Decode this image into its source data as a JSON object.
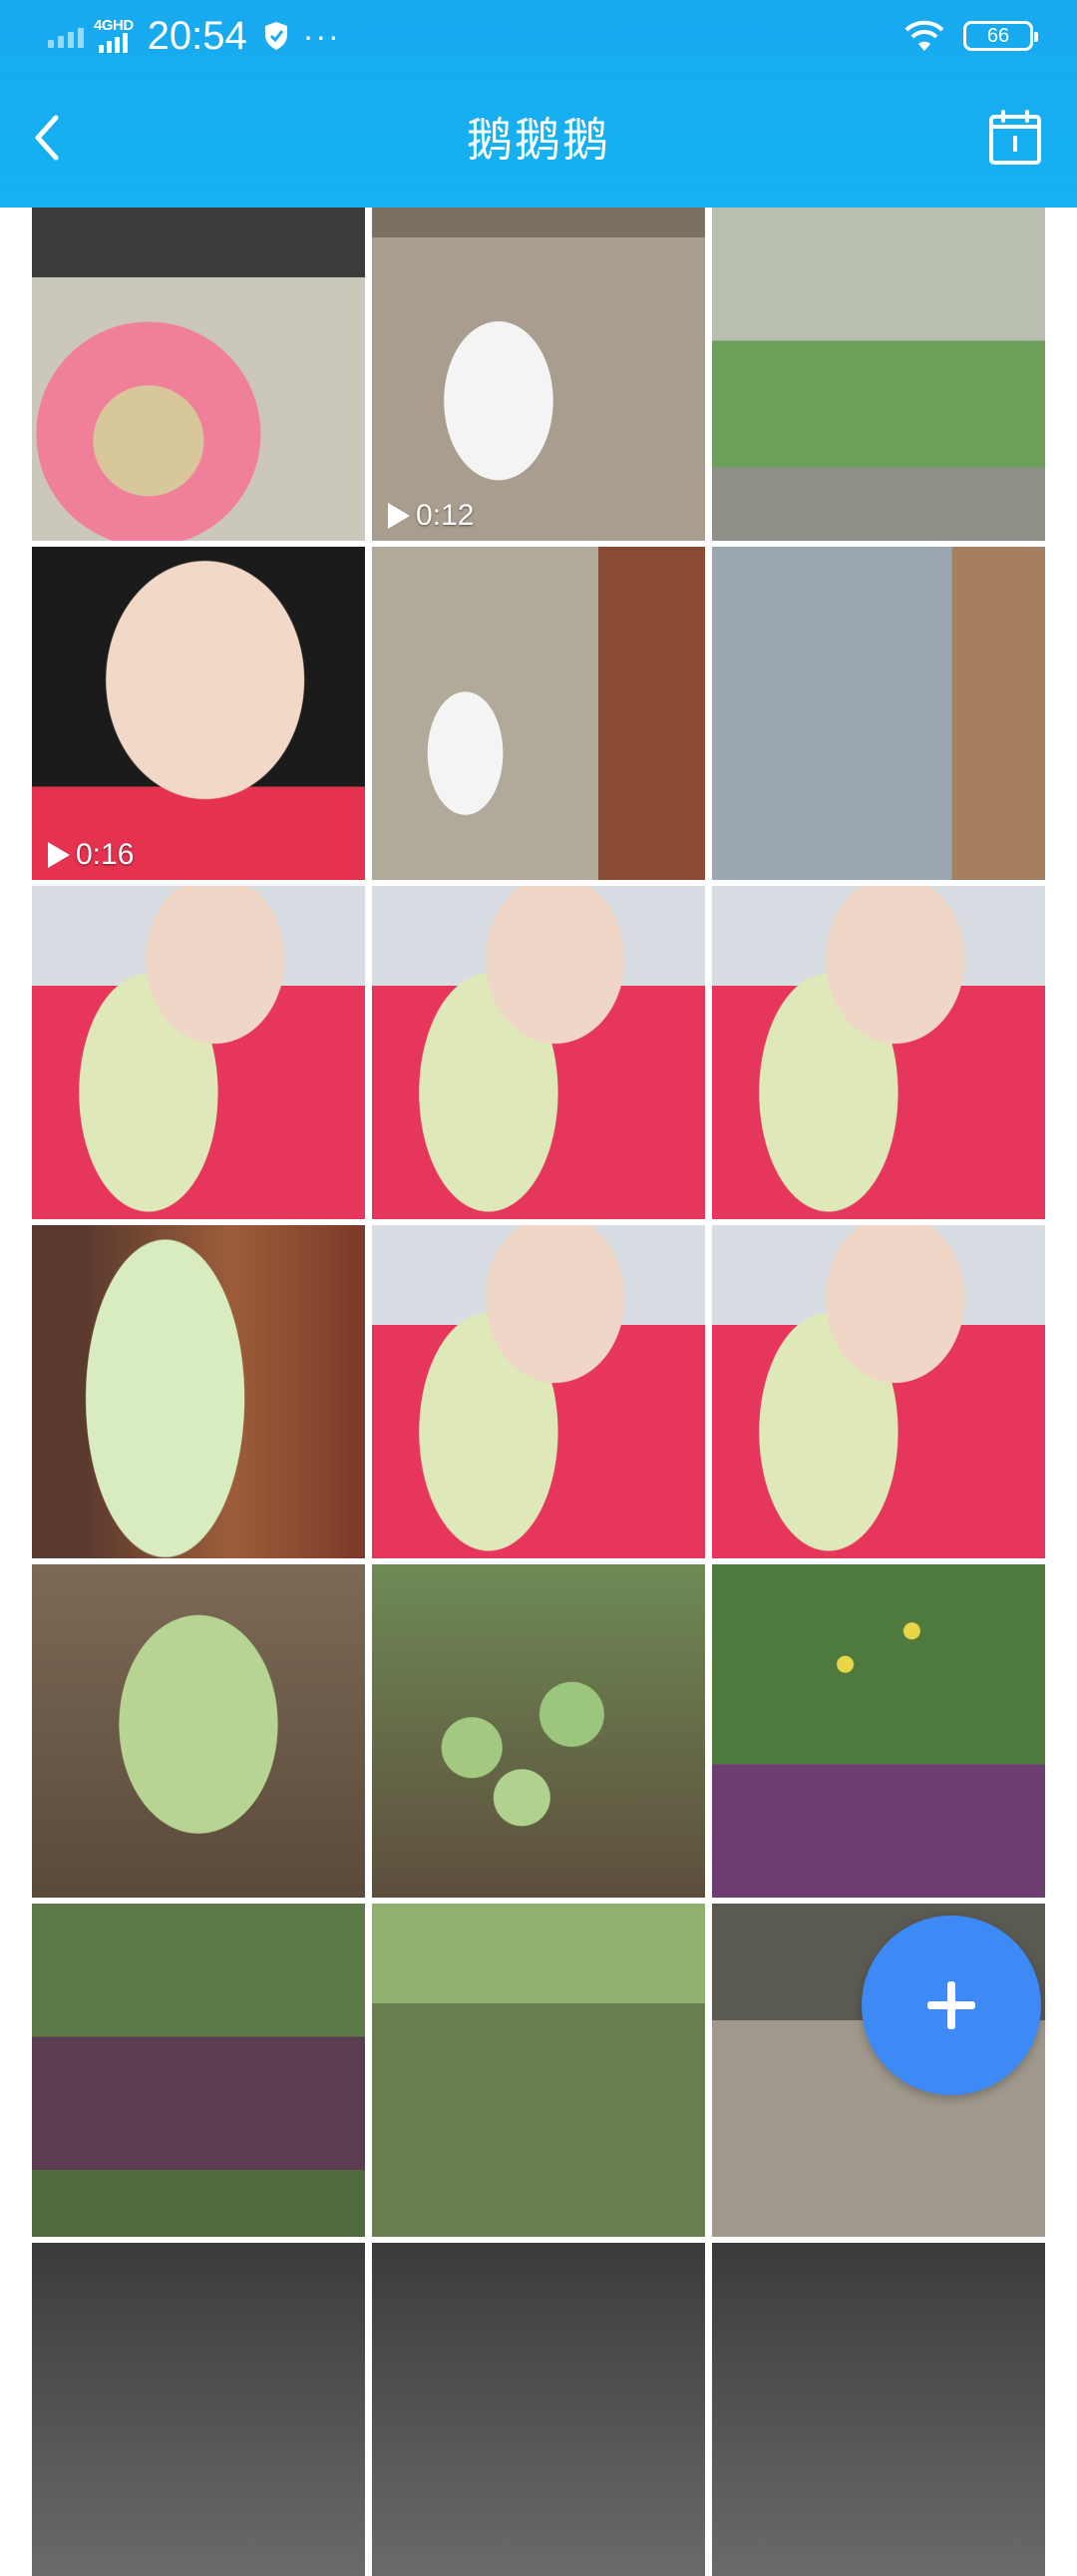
{
  "status_bar": {
    "network": "4GHD",
    "time": "20:54",
    "dots": "···",
    "battery": "66"
  },
  "header": {
    "title": "鹅鹅鹅",
    "back_icon": "chevron-left-icon",
    "calendar_icon": "calendar-icon"
  },
  "grid": {
    "tiles": [
      {
        "name": "photo-basket"
      },
      {
        "name": "video-goose",
        "duration": "0:12"
      },
      {
        "name": "photo-field"
      },
      {
        "name": "video-face",
        "duration": "0:16"
      },
      {
        "name": "photo-goose"
      },
      {
        "name": "photo-room"
      },
      {
        "name": "photo-girl-cabbage-1"
      },
      {
        "name": "photo-girl-cabbage-2"
      },
      {
        "name": "photo-girl-cabbage-3"
      },
      {
        "name": "photo-cabbage-closeup"
      },
      {
        "name": "photo-girl-cabbage-4"
      },
      {
        "name": "photo-girl-cabbage-5"
      },
      {
        "name": "photo-cabbage-field"
      },
      {
        "name": "photo-cabbage-rows"
      },
      {
        "name": "photo-flowering-veg"
      },
      {
        "name": "photo-veg-patch"
      },
      {
        "name": "photo-garden"
      },
      {
        "name": "photo-yard"
      },
      {
        "name": "photo-partial-1"
      },
      {
        "name": "photo-partial-2"
      },
      {
        "name": "photo-partial-3"
      }
    ]
  },
  "fab": {
    "icon": "plus-icon",
    "color": "#3d8af7"
  },
  "colors": {
    "header_bg": "#19a9ef",
    "text_on_header": "#ffffff"
  }
}
